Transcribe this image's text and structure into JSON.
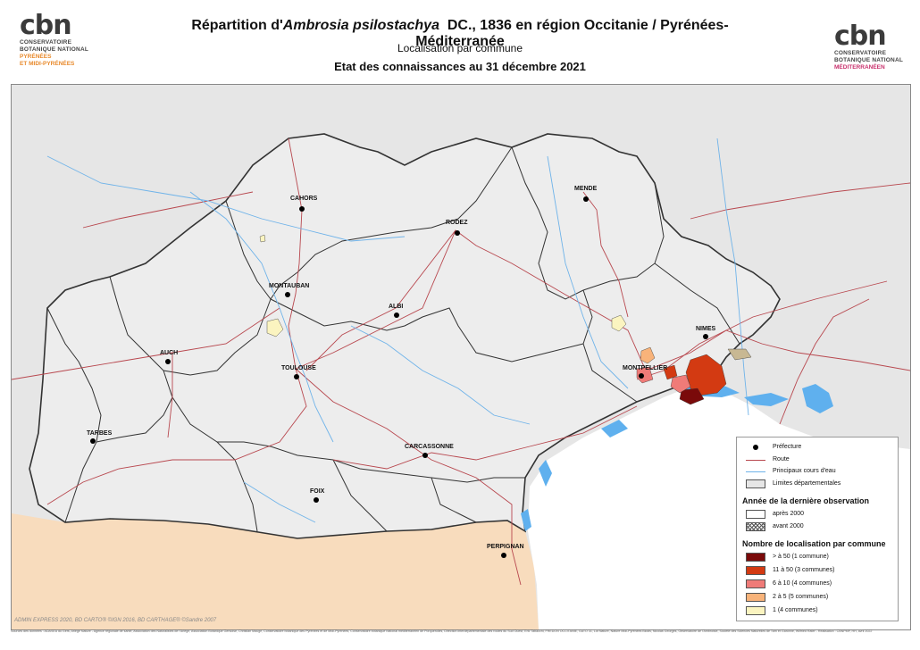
{
  "header": {
    "title_prefix": "Répartition d'",
    "title_species": "Ambrosia psilostachya",
    "title_suffix": "DC., 1836 en région Occitanie / Pyrénées-Méditerranée",
    "subtitle": "Localisation par commune",
    "date_line": "Etat des connaissances au 31 décembre 2021"
  },
  "logos": {
    "left": {
      "word": "cbn",
      "line1": "CONSERVATOIRE",
      "line2": "BOTANIQUE NATIONAL",
      "line3": "PYRÉNÉES",
      "line4": "ET MIDI-PYRÉNÉES"
    },
    "right": {
      "word": "cbn",
      "line1": "CONSERVATOIRE",
      "line2": "BOTANIQUE NATIONAL",
      "line3": "MÉDITERRANÉEN"
    }
  },
  "cities": [
    {
      "name": "CAHORS"
    },
    {
      "name": "RODEZ"
    },
    {
      "name": "MENDE"
    },
    {
      "name": "MONTAUBAN"
    },
    {
      "name": "ALBI"
    },
    {
      "name": "NIMES"
    },
    {
      "name": "AUCH"
    },
    {
      "name": "TOULOUSE"
    },
    {
      "name": "MONTPELLIER"
    },
    {
      "name": "TARBES"
    },
    {
      "name": "CARCASSONNE"
    },
    {
      "name": "FOIX"
    },
    {
      "name": "PERPIGNAN"
    }
  ],
  "legend": {
    "prefecture": "Préfecture",
    "road": "Route",
    "rivers": "Principaux cours d'eau",
    "dept_limits": "Limites départementales",
    "year_heading": "Année de la dernière observation",
    "after_2000": "après 2000",
    "before_2000": "avant 2000",
    "count_heading": "Nombre de localisation par commune",
    "classes": [
      {
        "label": "> à 50 (1 commune)",
        "color": "#7a0a0a"
      },
      {
        "label": "11 à 50 (3 communes)",
        "color": "#d33a12"
      },
      {
        "label": "6 à 10 (4 communes)",
        "color": "#ef7b78"
      },
      {
        "label": "2 à 5 (5 communes)",
        "color": "#f8b37a"
      },
      {
        "label": "1 (4 communes)",
        "color": "#fbf4c0"
      }
    ]
  },
  "colors": {
    "region_fill": "#ededed",
    "outside_fill": "#e6e6e6",
    "sea": "#ffffff",
    "spain": "#f8dcbd",
    "road": "#b8484f",
    "river": "#6fb3e9",
    "lagoon": "#5fb0ee",
    "dept": "#333333"
  },
  "credit": "ADMIN EXPRESS 2020, BD CARTO® ©IGN 2016, BD CARTHAGE® ©Sandre 2007",
  "source": "Sources des données : ADASEA du Gers, Ariège Nature - Agence régionale de santé, Association des Naturalistes de l'Ariège, Association Botanique Gersoise, Christian Maugé, Conservatoire botanique des Pyrénées et de Midi-Pyrénées, Conservatoire botanique national méditerranéen de Porquerolles, Direction interdépartementale des routes du Sud Ouest, Eric Tabacchi, FREDON OCCITANIE, GATO 31, Lot Nature, Nature Midi-Pyrénées Biodiv, Nicolas Georges, Observatoire de l'Ambroisie, Société des Sciences Naturelles de Tarn et Garonne, Wilfried Rater - Réalisation : CBNPMP, HH, avril 2022"
}
